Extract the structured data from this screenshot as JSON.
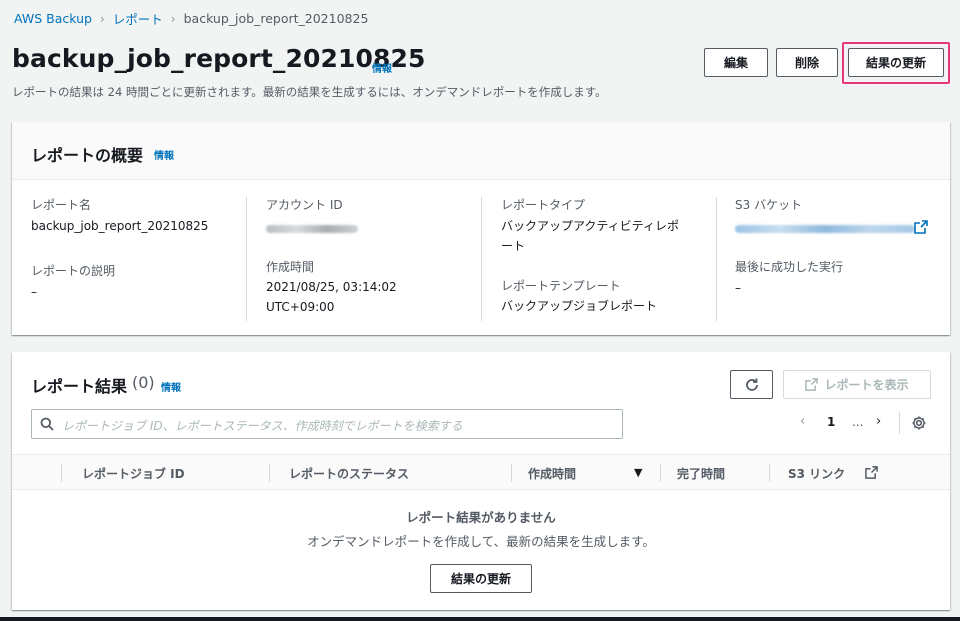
{
  "breadcrumb": {
    "items": [
      "AWS Backup",
      "レポート",
      "backup_job_report_20210825"
    ]
  },
  "header": {
    "title": "backup_job_report_20210825",
    "info": "情報",
    "description": "レポートの結果は 24 時間ごとに更新されます。最新の結果を生成するには、オンデマンドレポートを作成します。",
    "buttons": {
      "edit": "編集",
      "delete": "削除",
      "refresh": "結果の更新"
    },
    "highlight_color": "#e8347a"
  },
  "overview": {
    "title": "レポートの概要",
    "info": "情報",
    "report_name_label": "レポート名",
    "report_name_value": "backup_job_report_20210825",
    "report_desc_label": "レポートの説明",
    "report_desc_value": "–",
    "account_id_label": "アカウント ID",
    "created_label": "作成時間",
    "created_value_1": "2021/08/25, 03:14:02",
    "created_value_2": "UTC+09:00",
    "report_type_label": "レポートタイプ",
    "report_type_value_1": "バックアップアクティビティレポ",
    "report_type_value_2": "ート",
    "template_label": "レポートテンプレート",
    "template_value": "バックアップジョブレポート",
    "s3_bucket_label": "S3 バケット",
    "last_success_label": "最後に成功した実行",
    "last_success_value": "–"
  },
  "results": {
    "title": "レポート結果",
    "count": "(0)",
    "info": "情報",
    "view_report_label": "レポートを表示",
    "search_placeholder": "レポートジョブ ID、レポートステータス、作成時刻でレポートを検索する",
    "pagination": {
      "prev": "‹",
      "current_page": "1",
      "ellipsis": "...",
      "next": "›"
    },
    "columns": [
      "レポートジョブ ID",
      "レポートのステータス",
      "作成時間",
      "完了時間",
      "S3 リンク"
    ],
    "sort_indicator": "▼",
    "empty_title": "レポート結果がありません",
    "empty_description": "オンデマンドレポートを作成して、最新の結果を生成します。",
    "empty_button": "結果の更新"
  },
  "colors": {
    "link": "#0073bb",
    "page_bg": "#f2f3f3"
  }
}
